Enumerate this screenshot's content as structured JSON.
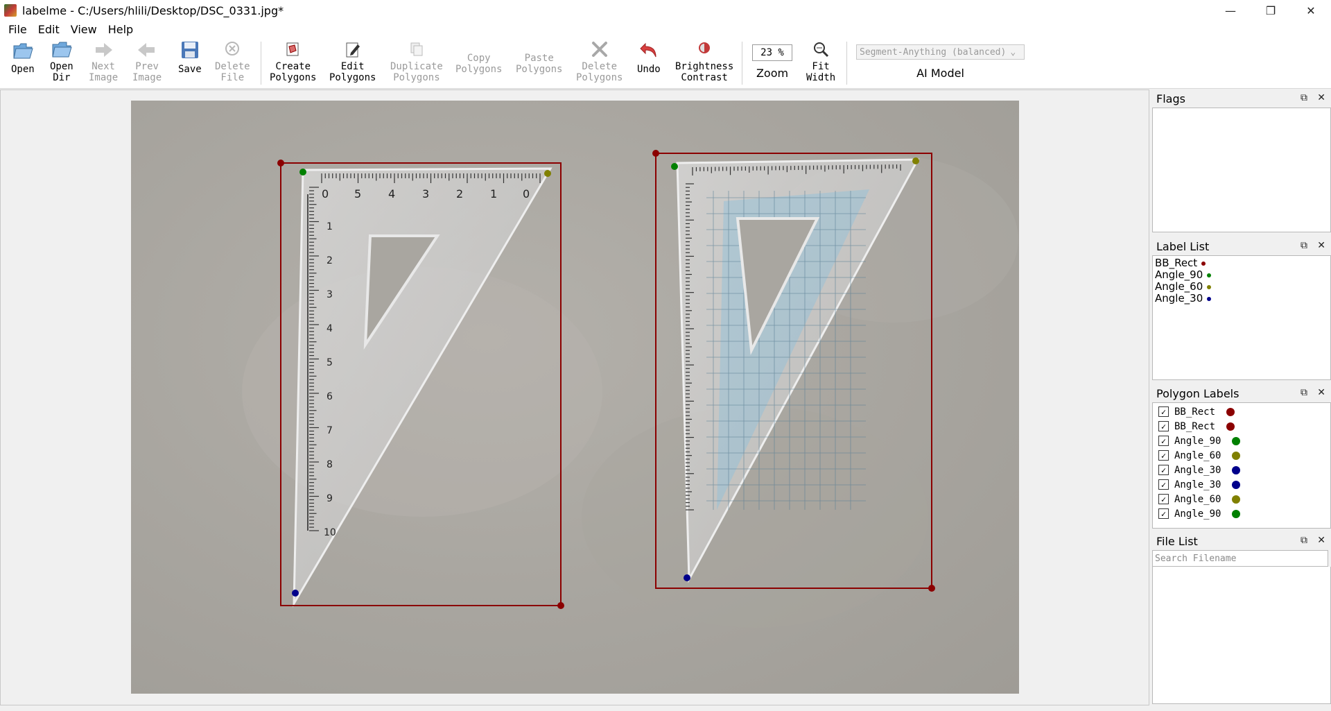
{
  "window": {
    "title": "labelme - C:/Users/hlili/Desktop/DSC_0331.jpg*",
    "minimize": "—",
    "maximize": "❐",
    "close": "✕"
  },
  "menu": [
    "File",
    "Edit",
    "View",
    "Help"
  ],
  "toolbar": {
    "open": "Open",
    "open_dir": [
      "Open",
      "Dir"
    ],
    "next_image": [
      "Next",
      "Image"
    ],
    "prev_image": [
      "Prev",
      "Image"
    ],
    "save": "Save",
    "delete_file": [
      "Delete",
      "File"
    ],
    "create_polygons": [
      "Create",
      "Polygons"
    ],
    "edit_polygons": [
      "Edit",
      "Polygons"
    ],
    "duplicate_polygons": [
      "Duplicate",
      "Polygons"
    ],
    "copy_polygons": [
      "Copy",
      "Polygons"
    ],
    "paste_polygons": [
      "Paste",
      "Polygons"
    ],
    "delete_polygons": [
      "Delete",
      "Polygons"
    ],
    "undo": "Undo",
    "brightness_contrast": [
      "Brightness",
      "Contrast"
    ],
    "zoom_value": "23 %",
    "zoom_label": "Zoom",
    "fit_width": [
      "Fit",
      "Width"
    ],
    "ai_model_value": "Segment-Anything (balanced)",
    "ai_model_label": "AI Model"
  },
  "colors": {
    "bb_rect": "#8b0000",
    "angle_90": "#008000",
    "angle_60": "#808000",
    "angle_30": "#00008b"
  },
  "ruler_numbers": {
    "left_top": [
      "0",
      "1",
      "2",
      "3",
      "4",
      "5",
      "0"
    ],
    "left_side": [
      "1",
      "2",
      "3",
      "4",
      "5",
      "6",
      "7",
      "8",
      "9",
      "10"
    ]
  },
  "flags": {
    "title": "Flags"
  },
  "label_list": {
    "title": "Label List",
    "items": [
      {
        "label": "BB_Rect",
        "color": "#8b0000"
      },
      {
        "label": "Angle_90",
        "color": "#008000"
      },
      {
        "label": "Angle_60",
        "color": "#808000"
      },
      {
        "label": "Angle_30",
        "color": "#00008b"
      }
    ]
  },
  "polygon_labels": {
    "title": "Polygon Labels",
    "items": [
      {
        "label": "BB_Rect",
        "color": "#8b0000"
      },
      {
        "label": "BB_Rect",
        "color": "#8b0000"
      },
      {
        "label": "Angle_90",
        "color": "#008000"
      },
      {
        "label": "Angle_60",
        "color": "#808000"
      },
      {
        "label": "Angle_30",
        "color": "#00008b"
      },
      {
        "label": "Angle_30",
        "color": "#00008b"
      },
      {
        "label": "Angle_60",
        "color": "#808000"
      },
      {
        "label": "Angle_90",
        "color": "#008000"
      }
    ]
  },
  "file_list": {
    "title": "File List",
    "search_placeholder": "Search Filename"
  }
}
